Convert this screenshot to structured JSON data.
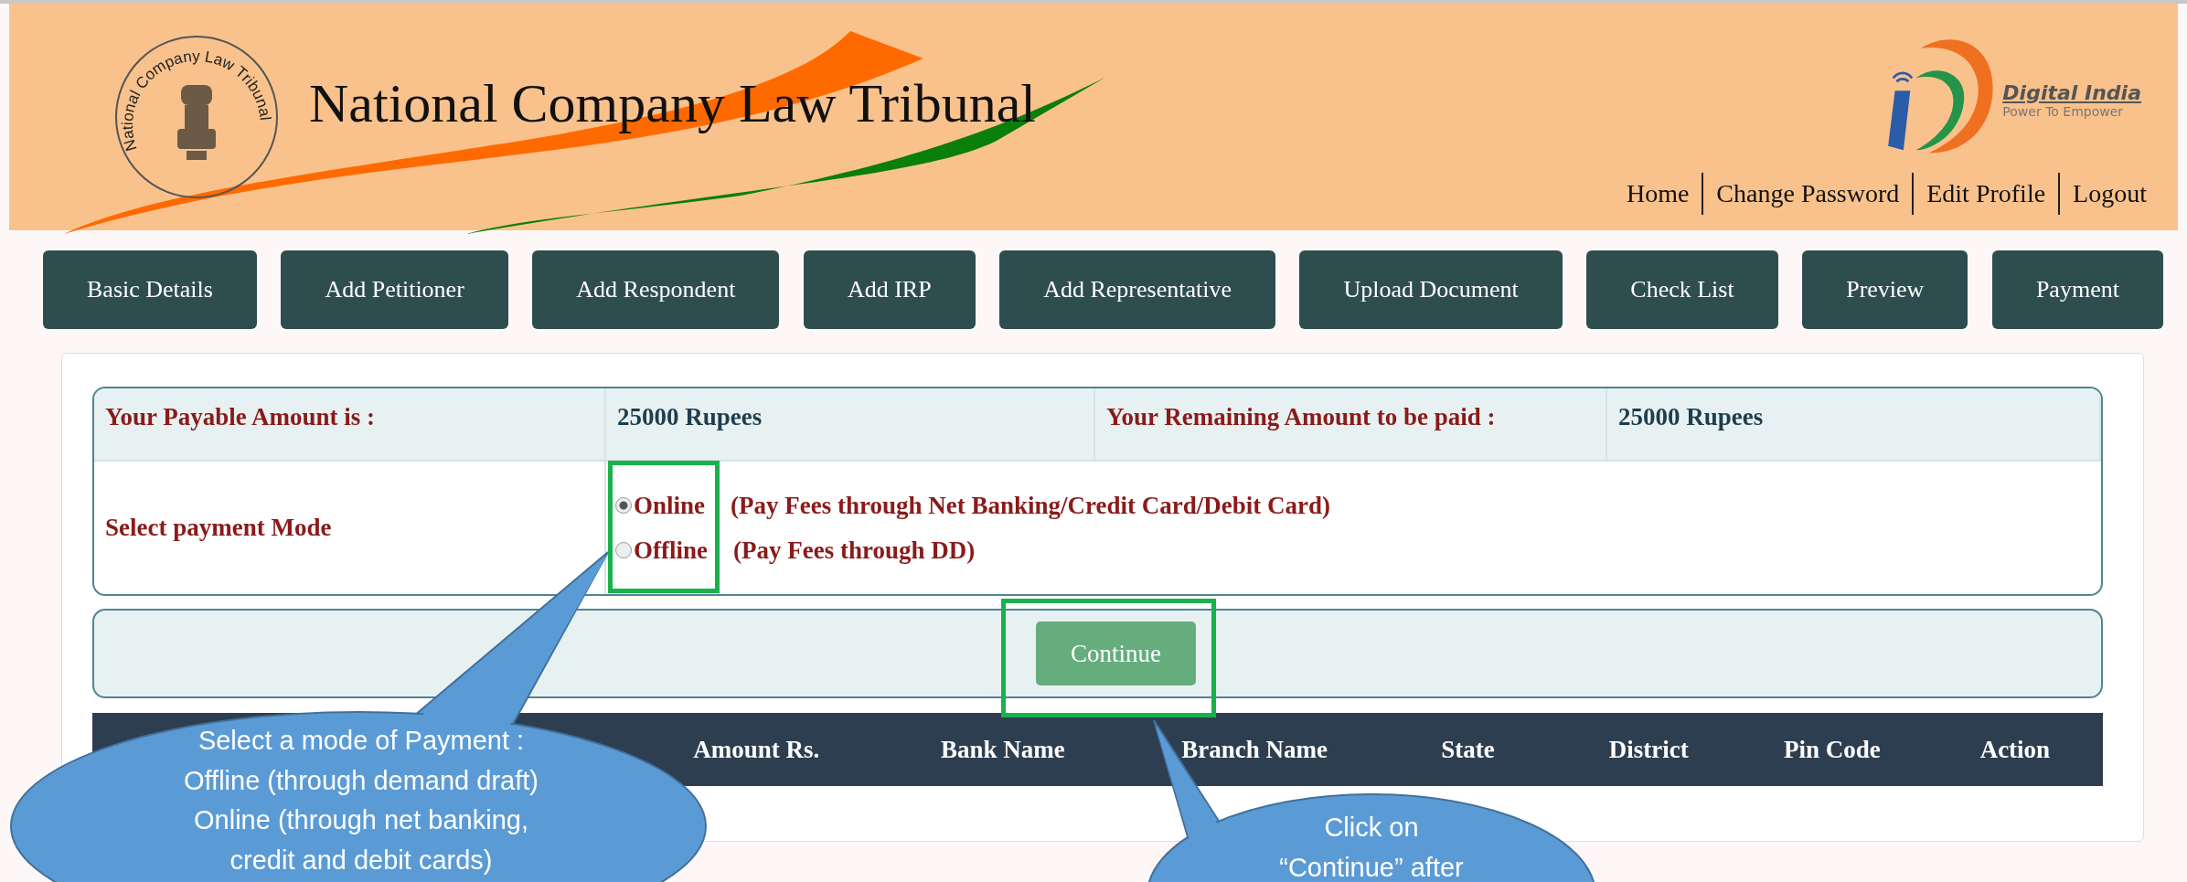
{
  "header": {
    "seal_text": "National Company Law Tribunal",
    "title": "National Company Law Tribunal",
    "logo_name": "Digital India",
    "logo_tagline": "Power To Empower",
    "links": [
      "Home",
      "Change Password",
      "Edit Profile",
      "Logout"
    ]
  },
  "steps": [
    "Basic Details",
    "Add Petitioner",
    "Add Respondent",
    "Add IRP",
    "Add Representative",
    "Upload Document",
    "Check List",
    "Preview",
    "Payment"
  ],
  "payment": {
    "amount_label": "Your Payable Amount is :",
    "amount_value": "25000 Rupees",
    "remaining_label": "Your Remaining Amount to be paid :",
    "remaining_value": "25000 Rupees",
    "mode_label": "Select payment Mode",
    "modes": [
      {
        "label": "Online",
        "note": "(Pay Fees through Net Banking/Credit Card/Debit Card)",
        "selected": true
      },
      {
        "label": "Offline",
        "note": "(Pay Fees through DD)",
        "selected": false
      }
    ],
    "continue_button": "Continue"
  },
  "dd_table": {
    "columns": [
      "Amount Rs.",
      "Bank Name",
      "Branch Name",
      "State",
      "District",
      "Pin Code",
      "Action"
    ]
  },
  "annotations": [
    {
      "lines": [
        "Select a mode of Payment :",
        "Offline (through demand draft)",
        "Online (through net banking,",
        "credit and debit cards)"
      ]
    },
    {
      "lines": [
        "Click on",
        "“Continue” after"
      ]
    }
  ]
}
